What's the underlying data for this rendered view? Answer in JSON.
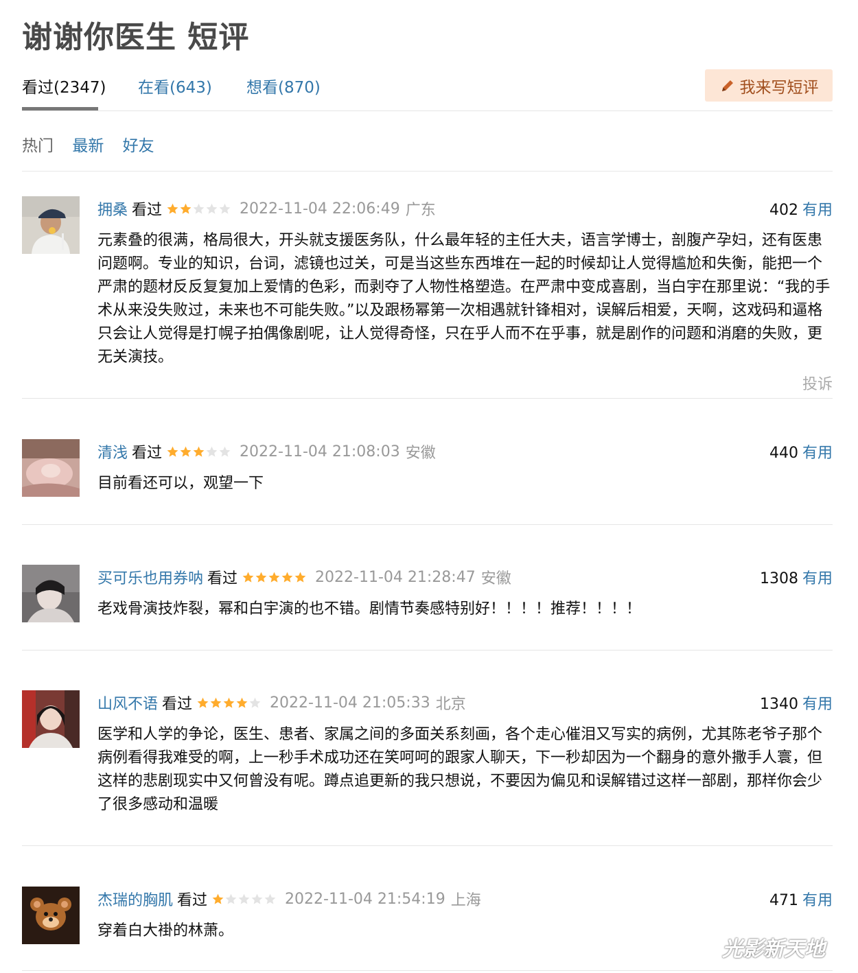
{
  "page_title": "谢谢你医生 短评",
  "tabs": [
    {
      "label": "看过(2347)"
    },
    {
      "label": "在看(643)"
    },
    {
      "label": "想看(870)"
    }
  ],
  "write_button": "我来写短评",
  "sort_options": [
    "热门",
    "最新",
    "好友"
  ],
  "comments": [
    {
      "user": "拥桑",
      "status": "看过",
      "rating": 2,
      "time": "2022-11-04 22:06:49",
      "location": "广东",
      "votes": "402",
      "useful_label": "有用",
      "text": "元素叠的很满，格局很大，开头就支援医务队，什么最年轻的主任大夫，语言学博士，剖腹产孕妇，还有医患问题啊。专业的知识，台词，滤镜也过关，可是当这些东西堆在一起的时候却让人觉得尴尬和失衡，能把一个严肃的题材反反复复加上爱情的色彩，而剥夺了人物性格塑造。在严肃中变成喜剧，当白宇在那里说：“我的手术从来没失败过，未来也不可能失败。”以及跟杨幂第一次相遇就针锋相对，误解后相爱，天啊，这戏码和逼格只会让人觉得是打幌子拍偶像剧呢，让人觉得奇怪，只在乎人而不在乎事，就是剧作的问题和消磨的失败，更无关演技。",
      "report": "投诉"
    },
    {
      "user": "清浅",
      "status": "看过",
      "rating": 3,
      "time": "2022-11-04 21:08:03",
      "location": "安徽",
      "votes": "440",
      "useful_label": "有用",
      "text": "目前看还可以，观望一下"
    },
    {
      "user": "买可乐也用券呐",
      "status": "看过",
      "rating": 5,
      "time": "2022-11-04 21:28:47",
      "location": "安徽",
      "votes": "1308",
      "useful_label": "有用",
      "text": "老戏骨演技炸裂，幂和白宇演的也不错。剧情节奏感特别好！！！！推荐！！！！"
    },
    {
      "user": "山风不语",
      "status": "看过",
      "rating": 4,
      "time": "2022-11-04 21:05:33",
      "location": "北京",
      "votes": "1340",
      "useful_label": "有用",
      "text": "医学和人学的争论，医生、患者、家属之间的多面关系刻画，各个走心催泪又写实的病例，尤其陈老爷子那个病例看得我难受的啊，上一秒手术成功还在笑呵呵的跟家人聊天，下一秒却因为一个翻身的意外撒手人寰，但这样的悲剧现实中又何曾没有呢。蹲点追更新的我只想说，不要因为偏见和误解错过这样一部剧，那样你会少了很多感动和温暖"
    },
    {
      "user": "杰瑞的胸肌",
      "status": "看过",
      "rating": 1,
      "time": "2022-11-04 21:54:19",
      "location": "上海",
      "votes": "471",
      "useful_label": "有用",
      "text": "穿着白大褂的林萧。"
    }
  ],
  "watermark": "光影新天地",
  "colors": {
    "link": "#3377aa",
    "star_on": "#ffac2d",
    "star_off": "#e3e3e3",
    "write_bg": "#fde6d6",
    "write_text": "#a14f1e"
  }
}
